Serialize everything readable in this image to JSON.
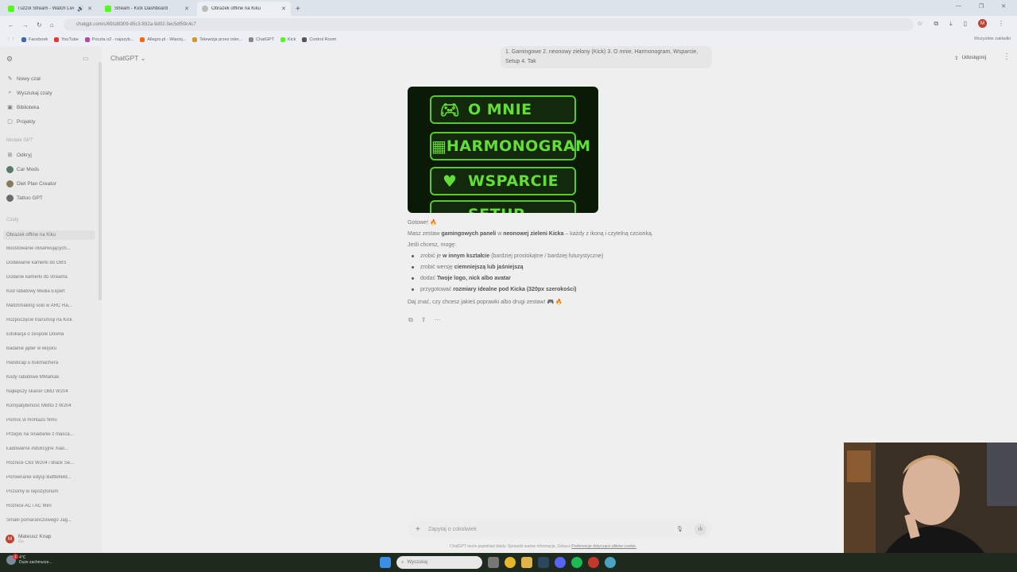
{
  "browser": {
    "tabs": [
      {
        "title": "Tuzzol Stream - Watch Live",
        "active": false
      },
      {
        "title": "Stream - Kick Dashboard",
        "active": false
      },
      {
        "title": "Obrazek offline na Kiku",
        "active": true
      }
    ],
    "url": "chatgpt.com/c/691d8309-85c3-832a-9d02-3ec5df59c4c7",
    "bookmarks": [
      "Facebook",
      "YouTube",
      "Poczta o2 - najszyb...",
      "Allegro.pl - Więcej...",
      "Telewizja przez inter...",
      "ChatGPT",
      "Kick",
      "Control Room"
    ],
    "bookmarks_all": "Wszystkie zakładki",
    "profile_initial": "M"
  },
  "sidebar": {
    "nav": [
      {
        "label": "Nowy czat",
        "icon": "edit-icon"
      },
      {
        "label": "Wyszukaj czaty",
        "icon": "search-icon"
      },
      {
        "label": "Biblioteka",
        "icon": "library-icon"
      },
      {
        "label": "Projekty",
        "icon": "folder-icon"
      }
    ],
    "gpt_section": "Modele GPT",
    "gpts": [
      "Odkryj",
      "Car Mods",
      "Diet Plan Creator",
      "Tattoo GPT"
    ],
    "chats_section": "Czaty",
    "chats": [
      "Obrazek offline na Kiku",
      "Boostowanie obserwujących...",
      "Dodawanie kamerki do OBS",
      "Dodanie kamerki do streama",
      "Kod rabatowy Media Expert",
      "Matchmaking solo w ARC Ra...",
      "Rozpoczęcie transmisji na Kick",
      "Edukacja o zespole Downa",
      "Badanie jąder w wojsku",
      "Handicap u bukmachera",
      "Kody rabatowe MMarkak",
      "Najlepszy skaner OBD W204",
      "Kompatybilność MBtto z W204",
      "Pomoc w montażu filmu",
      "Przepis na śniadanie z masca...",
      "Ładowarne indukcyjne Xiao...",
      "Różnice C63 W204 i Black Se...",
      "Porównanie edycji Battlefield...",
      "Poziomy w repozytorium",
      "Różnice AC i AC Mini",
      "Smaki pomarańczowego Jag..."
    ],
    "user": {
      "name": "Mateusz Knap",
      "plan": "Go",
      "initial": "M"
    }
  },
  "main": {
    "model": "ChatGPT",
    "share": "Udostępnij",
    "user_message": "1. Gamingowe 2. neonowy zielony (Kick) 3. O mnie, Harmonogram, Wsparcie, Setup 4. Tak",
    "panels": [
      {
        "label": "O MNIE",
        "icon": "gamepad-icon"
      },
      {
        "label": "HARMONOGRAM",
        "icon": "calendar-icon"
      },
      {
        "label": "WSPARCIE",
        "icon": "heart-icon"
      },
      {
        "label": "SETUP",
        "icon": "monitor-icon"
      }
    ],
    "panel_color": "#63de34",
    "response": {
      "line1": "Gotowe! 🔥",
      "line2_pre": "Masz zestaw ",
      "line2_b1": "gamingowych paneli",
      "line2_mid": " w ",
      "line2_b2": "neonowej zieleni Kicka",
      "line2_post": " – każdy z ikoną i czytelną czcionką.",
      "line3": "Jeśli chcesz, mogę:",
      "bullets": [
        {
          "pre": "zrobić je ",
          "b": "w innym kształcie",
          "post": " (bardziej prostokątne / bardziej futurystyczne)"
        },
        {
          "pre": "zrobić wersję ",
          "b": "ciemniejszą lub jaśniejszą",
          "post": ""
        },
        {
          "pre": "dodać ",
          "b": "Twoje logo, nick albo avatar",
          "post": ""
        },
        {
          "pre": "przygotować ",
          "b": "rozmiary idealne pod Kicka (320px szerokości)",
          "post": ""
        }
      ],
      "closing": "Daj znać, czy chcesz jakieś poprawki albo drugi zestaw! 🎮 🔥"
    },
    "composer_placeholder": "Zapytaj o cokolwiek",
    "disclaimer": "ChatGPT może popełniać błędy. Sprawdź ważne informacje. Zobacz",
    "disclaimer_link": "Preferencje dotyczące plików cookie."
  },
  "taskbar": {
    "weather_temp": "4°C",
    "weather_desc": "Duże zachmurze...",
    "badge": "1",
    "search": "Wyszukaj"
  }
}
